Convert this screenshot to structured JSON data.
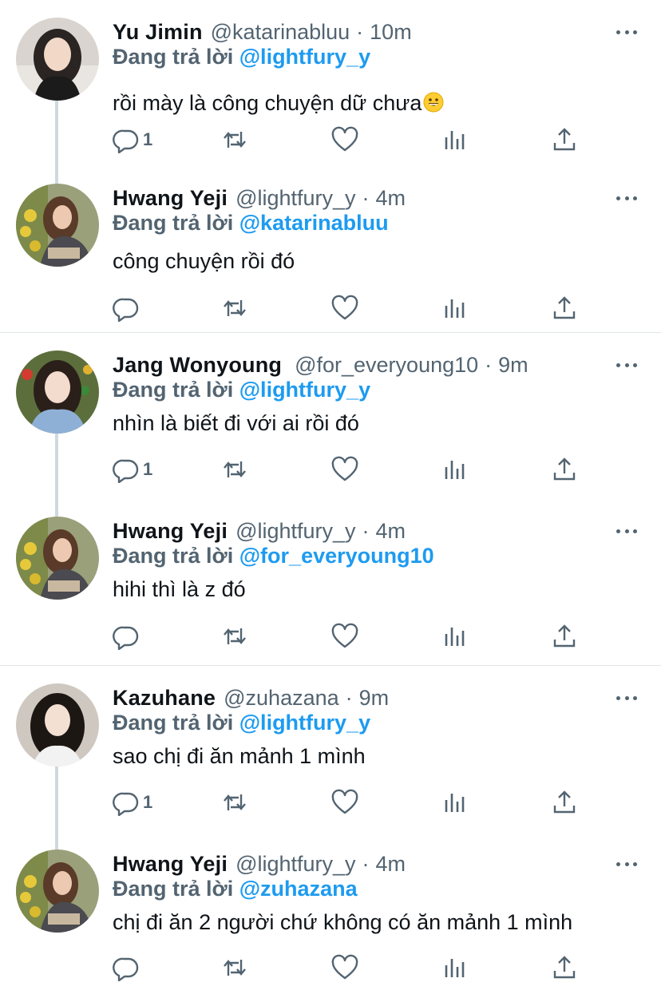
{
  "reply_prefix": "Đang trả lời",
  "separator": "·",
  "threads": [
    {
      "tweets": [
        {
          "name": "Yu Jimin",
          "handle": "@katarinabluu",
          "time": "10m",
          "reply_to": "@lightfury_y",
          "text": "rồi mày là công chuyện dữ chưa",
          "emoji": "grinning-face",
          "reply_count": "1",
          "avatar": "avatar-jimin"
        },
        {
          "name": "Hwang Yeji",
          "handle": "@lightfury_y",
          "time": "4m",
          "reply_to": "@katarinabluu",
          "text": "công chuyện rồi đó",
          "reply_count": "",
          "avatar": "avatar-yeji"
        }
      ]
    },
    {
      "tweets": [
        {
          "name": "Jang Wonyoung",
          "handle": "@for_everyoung10",
          "time": "9m",
          "reply_to": "@lightfury_y",
          "text": "nhìn là biết đi với ai rồi đó",
          "reply_count": "1",
          "avatar": "avatar-wonyoung"
        },
        {
          "name": "Hwang Yeji",
          "handle": "@lightfury_y",
          "time": "4m",
          "reply_to": "@for_everyoung10",
          "text": "hihi thì là z đó",
          "reply_count": "",
          "avatar": "avatar-yeji"
        }
      ]
    },
    {
      "tweets": [
        {
          "name": "Kazuhane",
          "handle": "@zuhazana",
          "time": "9m",
          "reply_to": "@lightfury_y",
          "text": "sao chị đi ăn mảnh 1 mình",
          "reply_count": "1",
          "avatar": "avatar-kazuha"
        },
        {
          "name": "Hwang Yeji",
          "handle": "@lightfury_y",
          "time": "4m",
          "reply_to": "@zuhazana",
          "text": "chị đi ăn 2 người chứ không có ăn mảnh 1 mình",
          "reply_count": "",
          "avatar": "avatar-yeji"
        }
      ]
    }
  ],
  "icons": {
    "reply": "reply-icon",
    "retweet": "retweet-icon",
    "like": "heart-icon",
    "views": "views-icon",
    "share": "share-icon",
    "more": "more-icon"
  },
  "colors": {
    "mention": "#1d9bf0",
    "secondary": "#536471",
    "text": "#0f1419",
    "divider": "#e1e5e9",
    "thread_line": "#cfd9de"
  }
}
